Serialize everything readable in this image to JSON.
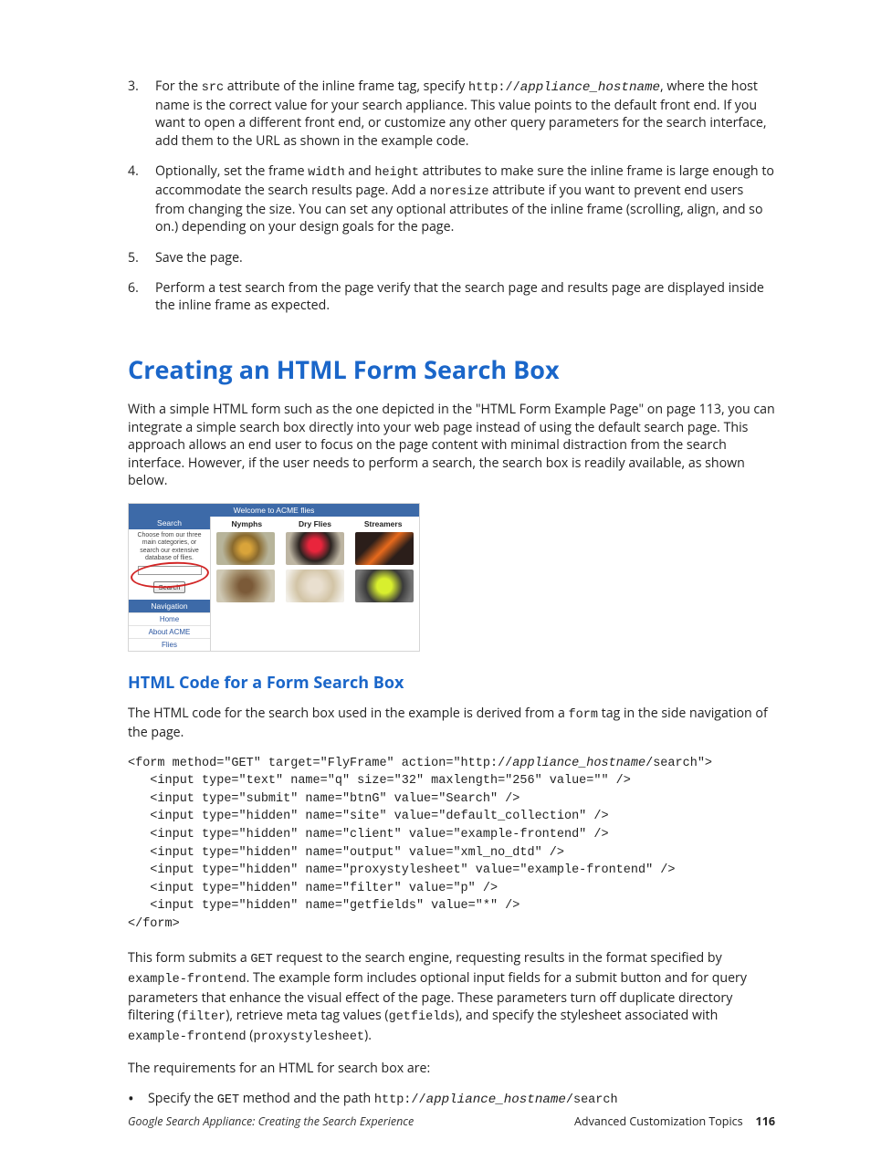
{
  "list": {
    "item3": {
      "num": "3.",
      "pre": "For the ",
      "code1": "src",
      "mid1": " attribute of the inline frame tag, specify ",
      "code2_a": "http://",
      "code2_b": "appliance_hostname",
      "mid2": ", where the host name is the correct value for your search appliance. This value points to the default front end. If you want to open a different front end, or customize any other query parameters for the search interface, add them to the URL as shown in the example code."
    },
    "item4": {
      "num": "4.",
      "pre": "Optionally, set the frame ",
      "code1": "width",
      "mid1": " and ",
      "code2": "height",
      "mid2": " attributes to make sure the inline frame is large enough to accommodate the search results page. Add a ",
      "code3": "noresize",
      "mid3": " attribute if you want to prevent end users from changing the size. You can set any optional attributes of the inline frame (scrolling, align, and so on.) depending on your design goals for the page."
    },
    "item5": {
      "num": "5.",
      "text": "Save the page."
    },
    "item6": {
      "num": "6.",
      "text": "Perform a test search from the page verify that the search page and results page are displayed inside the inline frame as expected."
    }
  },
  "h1": "Creating an HTML Form Search Box",
  "p_intro": "With a simple HTML form such as the one depicted in the \"HTML Form Example Page\" on page 113, you can integrate a simple search box directly into your web page instead of using the default search page. This approach allows an end user to focus on the page content with minimal distraction from the search interface. However, if the user needs to perform a search, the search box is readily available, as shown below.",
  "example": {
    "welcome": "Welcome to ACME flies",
    "search_hdr": "Search",
    "side_text": "Choose from our three main categories, or search our extensive database of flies.",
    "search_btn": "Search",
    "nav_hdr": "Navigation",
    "nav_items": [
      "Home",
      "About ACME",
      "Flies"
    ],
    "cols": [
      "Nymphs",
      "Dry Flies",
      "Streamers"
    ]
  },
  "h2": "HTML Code for a Form Search Box",
  "p_code_intro_a": "The HTML code for the search box used in the example is derived from a ",
  "p_code_intro_code": "form",
  "p_code_intro_b": " tag in the side navigation of the page.",
  "code": {
    "l1a": "<form method=\"GET\" target=\"FlyFrame\" action=\"http://",
    "l1b": "appliance_hostname",
    "l1c": "/search\">",
    "l2": "   <input type=\"text\" name=\"q\" size=\"32\" maxlength=\"256\" value=\"\" />",
    "l3": "   <input type=\"submit\" name=\"btnG\" value=\"Search\" />",
    "l4": "   <input type=\"hidden\" name=\"site\" value=\"default_collection\" />",
    "l5": "   <input type=\"hidden\" name=\"client\" value=\"example-frontend\" />",
    "l6": "   <input type=\"hidden\" name=\"output\" value=\"xml_no_dtd\" />",
    "l7": "   <input type=\"hidden\" name=\"proxystylesheet\" value=\"example-frontend\" />",
    "l8": "   <input type=\"hidden\" name=\"filter\" value=\"p\" />",
    "l9": "   <input type=\"hidden\" name=\"getfields\" value=\"*\" />",
    "l10": "</form>"
  },
  "p_after1": {
    "a": "This form submits a ",
    "c1": "GET",
    "b": " request to the search engine, requesting results in the format specified by ",
    "c2": "example-frontend",
    "c": ". The example form includes optional input fields for a submit button and for query parameters that enhance the visual effect of the page. These parameters turn off duplicate directory filtering (",
    "c3": "filter",
    "d": "), retrieve meta tag values (",
    "c4": "getfields",
    "e": "), and specify the stylesheet associated with ",
    "c5": "example-frontend",
    "f": " (",
    "c6": "proxystylesheet",
    "g": ")."
  },
  "p_req": "The requirements for an HTML for search box are:",
  "bullet1": {
    "a": "Specify the ",
    "c1": "GET",
    "b": " method and the path ",
    "c2a": "http://",
    "c2b": "appliance_hostname",
    "c2c": "/search"
  },
  "footer": {
    "left": "Google Search Appliance: Creating the Search Experience",
    "right": "Advanced Customization Topics",
    "page": "116"
  }
}
